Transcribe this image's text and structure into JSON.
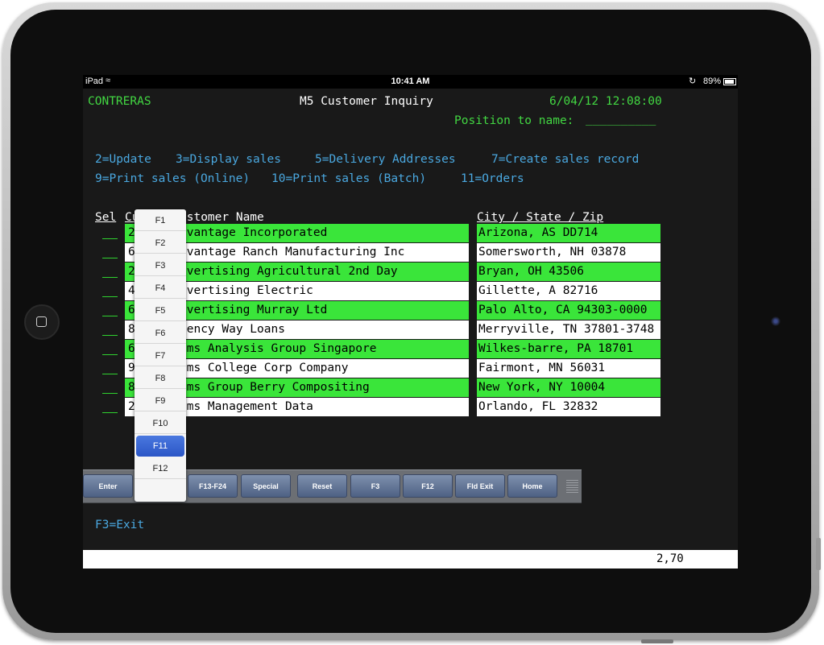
{
  "device": {
    "carrier": "iPad",
    "time": "10:41 AM",
    "battery": "89%",
    "battery_level": 0.89
  },
  "terminal": {
    "user": "CONTRERAS",
    "title": "M5 Customer Inquiry",
    "datetime": "6/04/12 12:08:00",
    "position_label": "Position to name:",
    "position_value": "__________",
    "options_line1": [
      "2=Update",
      "3=Display sales",
      "5=Delivery Addresses",
      "7=Create sales record"
    ],
    "options_line2": [
      "9=Print sales (Online)",
      "10=Print sales (Batch)",
      "11=Orders"
    ],
    "headers": {
      "sel": "Sel",
      "cust": "Cu",
      "name": "ustomer Name",
      "city": "City / State / Zip"
    },
    "rows": [
      {
        "num": "2",
        "name": "dvantage Incorporated",
        "city": "Arizona, AS DD714"
      },
      {
        "num": "6",
        "name": "dvantage Ranch Manufacturing Inc",
        "city": "Somersworth, NH 03878"
      },
      {
        "num": "2",
        "name": "dvertising Agricultural 2nd Day",
        "city": "Bryan, OH 43506"
      },
      {
        "num": "4",
        "name": "dvertising Electric",
        "city": "Gillette, A  82716"
      },
      {
        "num": "6",
        "name": "dvertising Murray Ltd",
        "city": "Palo Alto, CA 94303-0000"
      },
      {
        "num": "8",
        "name": "gency Way Loans",
        "city": "Merryville, TN 37801-3748"
      },
      {
        "num": "6",
        "name": "ims Analysis Group Singapore",
        "city": "Wilkes-barre, PA 18701"
      },
      {
        "num": "9",
        "name": "ims College Corp Company",
        "city": "Fairmont, MN 56031"
      },
      {
        "num": "8",
        "name": "ims Group Berry Compositing",
        "city": "New York, NY 10004"
      },
      {
        "num": "2",
        "name": "ims Management Data",
        "city": "Orlando, FL 32832"
      }
    ],
    "footer": "F3=Exit",
    "cursor_pos": "2,70"
  },
  "toolbar": {
    "buttons": [
      "Enter",
      "F13-F24",
      "Special",
      "Reset",
      "F3",
      "F12",
      "Fld Exit",
      "Home"
    ]
  },
  "popup": {
    "items": [
      "F1",
      "F2",
      "F3",
      "F4",
      "F5",
      "F6",
      "F7",
      "F8",
      "F9",
      "F10",
      "F11",
      "F12"
    ],
    "selected": "F11"
  },
  "colors": {
    "terminal_green": "#42d742",
    "terminal_blue": "#4aa8e0",
    "row_highlight": "#3ae53a",
    "popup_selected": "#2b56c6"
  }
}
